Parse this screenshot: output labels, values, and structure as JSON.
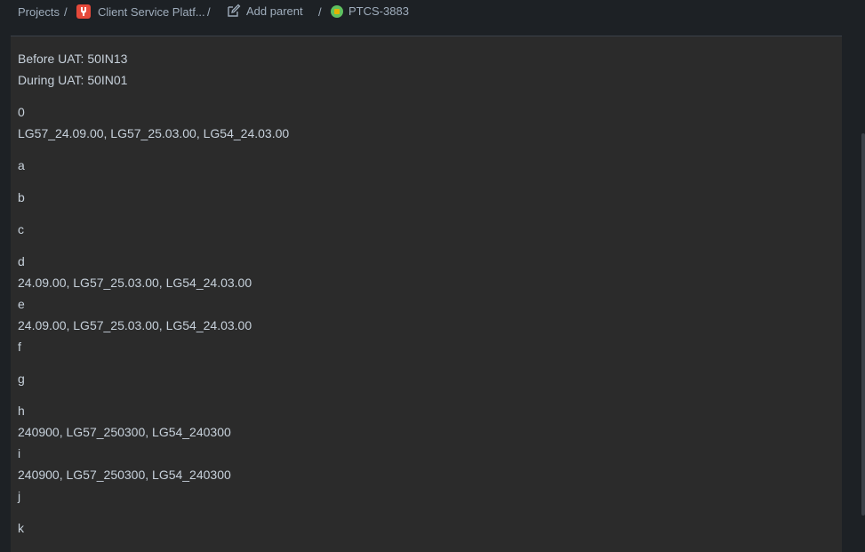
{
  "breadcrumb": {
    "projects": "Projects",
    "project_name": "Client Service Platf...",
    "add_parent": "Add parent",
    "issue_key": "PTCS-3883",
    "separator": "/"
  },
  "content": {
    "uat_before": "Before UAT: 50IN13",
    "uat_during": "During UAT: 50IN01",
    "label_0": "0",
    "value_0": "LG57_24.09.00, LG57_25.03.00, LG54_24.03.00",
    "label_a": "a",
    "label_b": "b",
    "label_c": "c",
    "label_d": "d",
    "value_d": "24.09.00, LG57_25.03.00, LG54_24.03.00",
    "label_e": "e",
    "value_e": "24.09.00, LG57_25.03.00, LG54_24.03.00",
    "label_f": "f",
    "label_g": "g",
    "label_h": "h",
    "value_h": "240900, LG57_250300, LG54_240300",
    "label_i": "i",
    "value_i": "240900, LG57_250300, LG54_240300",
    "label_j": "j",
    "label_k": "k"
  },
  "colors": {
    "background": "#1d2125",
    "panel": "#2b2b2b",
    "text": "#c7d1db",
    "project_icon": "#e5493a",
    "issue_icon": "#5fc05f"
  }
}
